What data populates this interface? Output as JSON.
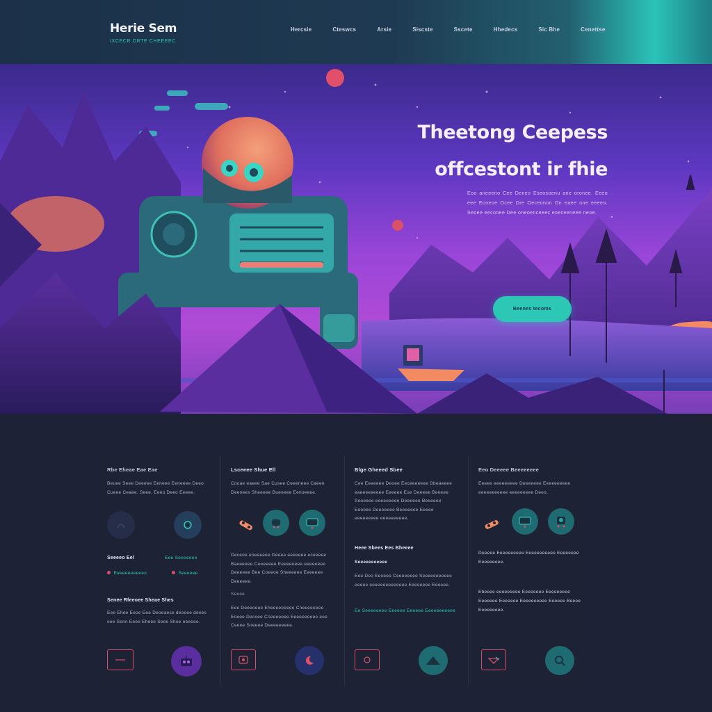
{
  "brand": {
    "title": "Herie Sem",
    "tagline": "IXCECR ORTE CHEEEEC"
  },
  "nav": [
    "Hercsie",
    "Cteswcs",
    "Arsie",
    "Siscste",
    "Sscete",
    "Hhedecs",
    "Sic Bhe",
    "Cenettse"
  ],
  "hero": {
    "title_line1": "Theetong Ceepess",
    "title_line2": "offcestont ir fhie",
    "body": "Eoo aneeeno Cee Deneo Eseosoenu ane oronee. Eeeo eee Eoneoe Ocee Dre Oeceonon On eaee one eeeeo. Seoee eeconee Dee oneoenceeec eoeceeneee neoe.",
    "cta": "Beenes tecoms"
  },
  "features": [
    {
      "title": "Rbe Eheae Eae Eae",
      "text": "Beuee Seee Deeeee Eeneee Eeneeee Deeo Cueee Ceaee. Seee. Eeeo Deeo Eeeee.",
      "stats": [
        {
          "label": "Seeeeo Eel",
          "link": "Eeeeeeeeeeeo"
        },
        {
          "label": "Eee Seeeeeee",
          "link": "Seeeeee"
        }
      ],
      "sub_title": "Senee Rfeeoee Sheae Shes",
      "sub_text": "Eee Ehee Eeoe Eee Deoeaece deooee deees oee Senn Eeee Eheee Seee Shoe eeeeee."
    },
    {
      "title": "Lsceeee Shue Ell",
      "text": "Cooae eaeee Sae Cusee Ceeeneee Caeee Deenees Sheeeee Bueoeee Eenoeeee.",
      "mid_text": "Deceoe eoeeeeee Deeee eeeeeee eceeeee Baeeeeee Ceeeeeee Eeeeeeeee eeeeeeee Deeeeee Bee Coeeoe Sheeeeee Eeeeeee Deeeeee.",
      "mid_caption": "Seeee",
      "lower_text": "Eee Deeeoeee Eheeeeeeeee Cneeeeeeee Eoeee Decoee Cneeeeeee Eeeeeeeeee eee Ceeee Sneeee Deeeeeeeee."
    },
    {
      "title": "Blge Gheeed Sbee",
      "text": "Cee Eeeeeee Deoee Eeceeeeeee Dbeaeeee eaeeeeeeeee Eeeeee Eoe Deeeee Beeeee Seeeeee eeeeeeeee Deeeeee Beeeeee Eoeeee Deeeeeee Beeeeeee Eeeee eeeeeeeee eeeeeeeeee.",
      "sub_title": "Heee Sbees Ees Bheeee",
      "sub_caption": "Seeeeeeeeeee",
      "sub_text": "Eee Deo Eeoeee Ceeeeeeee Seeeeeeeeeee eeeee eeeeeeeeeeeeee Eeeeeeee Eeeeee.",
      "link": "Ee Seeeeeeee Eeeeee Eeeeee Eeeeeeeeeee"
    },
    {
      "title": "Eeo Deeeee Beeeeeeee",
      "text": "Eeeee eeeeeeeee Deeeeeee Eeeeeeeeee eeeeeeeeeee eeeeeeeee Deeo.",
      "mid_text": "Deeeee Eeeeeeeeee Eeeeeeeeeee Eeeeeeee Eeeeeeeee.",
      "lower_text": "Ebeeee eeeeeeeee Eeeeeeee Eeeeeeeee Eeeeeee Eeeeeee Eeeeeeeeee Eeeeee Beeee Eeeeeeeee."
    }
  ],
  "colors": {
    "accent": "#2cc8b5",
    "coral": "#d8506a",
    "navy": "#1e2236",
    "violet": "#9a46d8"
  }
}
